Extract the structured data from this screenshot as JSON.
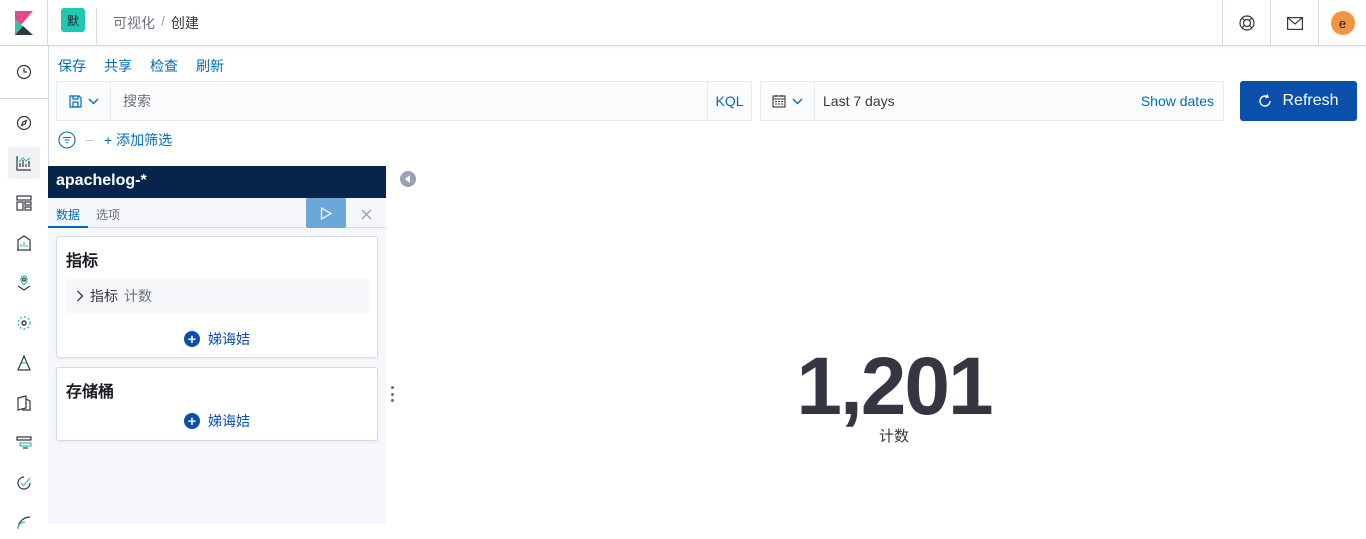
{
  "header": {
    "space_initial": "默",
    "breadcrumbs": [
      "可视化",
      "创建"
    ],
    "separator": "/",
    "user_initial": "e"
  },
  "colors": {
    "brand_pink": "#e8488b",
    "brand_teal": "#3ebeb0",
    "space_badge": "#1fc8b0",
    "link_blue": "#006bb4",
    "primary_button": "#0b4fac",
    "index_header": "#07254b",
    "avatar": "#f29542"
  },
  "sidenav": {
    "items": [
      "recently-viewed-icon",
      "discover-icon",
      "visualize-icon",
      "dashboard-icon",
      "canvas-icon",
      "maps-icon",
      "machine-learning-icon",
      "infrastructure-icon",
      "logs-icon",
      "apm-icon",
      "uptime-icon",
      "siem-icon"
    ]
  },
  "toolbar": {
    "menu": [
      "保存",
      "共享",
      "检查",
      "刷新"
    ],
    "search_placeholder": "搜索",
    "query_language": "KQL",
    "date_range": "Last 7 days",
    "show_dates": "Show dates",
    "refresh_label": "Refresh",
    "add_filter": "+ 添加筛选"
  },
  "editor": {
    "index_pattern": "apachelog-*",
    "tabs": [
      "数据",
      "选项"
    ],
    "metrics_panel": {
      "title": "指标",
      "agg_title": "指标",
      "agg_sub": "计数",
      "add_label": "娣诲姞"
    },
    "buckets_panel": {
      "title": "存储桶",
      "add_label": "娣诲姞"
    }
  },
  "visualization": {
    "metric_value": "1,201",
    "metric_label": "计数"
  }
}
